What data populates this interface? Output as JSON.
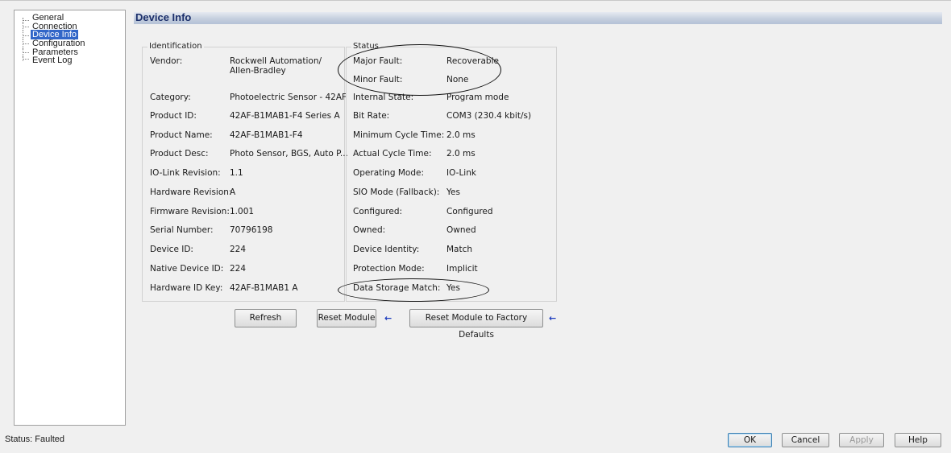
{
  "tree": {
    "items": [
      {
        "label": "General"
      },
      {
        "label": "Connection"
      },
      {
        "label": "Device Info"
      },
      {
        "label": "Configuration"
      },
      {
        "label": "Parameters"
      },
      {
        "label": "Event Log"
      }
    ],
    "selected": "Device Info"
  },
  "header": {
    "title": "Device Info"
  },
  "identification": {
    "title": "Identification",
    "rows": [
      {
        "label": "Vendor:",
        "value": "Rockwell Automation/",
        "value2": "Allen-Bradley"
      },
      {
        "label": "Category:",
        "value": "Photoelectric Sensor - 42AF"
      },
      {
        "label": "Product ID:",
        "value": "42AF-B1MAB1-F4 Series A"
      },
      {
        "label": "Product Name:",
        "value": "42AF-B1MAB1-F4"
      },
      {
        "label": "Product Desc:",
        "value": "Photo Sensor, BGS, Auto P..."
      },
      {
        "label": "IO-Link Revision:",
        "value": "1.1"
      },
      {
        "label": "Hardware Revision:",
        "value": "A"
      },
      {
        "label": "Firmware Revision:",
        "value": "1.001"
      },
      {
        "label": "Serial Number:",
        "value": "70796198"
      },
      {
        "label": "Device ID:",
        "value": "224"
      },
      {
        "label": "Native Device ID:",
        "value": "224"
      },
      {
        "label": "Hardware ID Key:",
        "value": "42AF-B1MAB1 A"
      }
    ]
  },
  "status": {
    "title": "Status",
    "rows": [
      {
        "label": "Major Fault:",
        "value": "Recoverable"
      },
      {
        "label": "Minor Fault:",
        "value": "None"
      },
      {
        "label": "Internal State:",
        "value": "Program mode"
      },
      {
        "label": "Bit Rate:",
        "value": "COM3 (230.4 kbit/s)"
      },
      {
        "label": "Minimum Cycle Time:",
        "value": "2.0 ms"
      },
      {
        "label": "Actual Cycle Time:",
        "value": "2.0 ms"
      },
      {
        "label": "Operating Mode:",
        "value": "IO-Link"
      },
      {
        "label": "SIO Mode (Fallback):",
        "value": "Yes"
      },
      {
        "label": "Configured:",
        "value": "Configured"
      },
      {
        "label": "Owned:",
        "value": "Owned"
      },
      {
        "label": "Device Identity:",
        "value": "Match"
      },
      {
        "label": "Protection Mode:",
        "value": "Implicit"
      },
      {
        "label": "Data Storage Match:",
        "value": "Yes"
      }
    ]
  },
  "actions": {
    "refresh": "Refresh",
    "reset_module": "Reset Module",
    "reset_factory": "Reset Module to Factory Defaults",
    "arrow_icon": "left-arrow-icon",
    "arrow_color": "#1c3bbd"
  },
  "footer": {
    "status": "Status: Faulted",
    "ok": "OK",
    "cancel": "Cancel",
    "apply": "Apply",
    "help": "Help"
  },
  "colors": {
    "header_text": "#1b2f6b",
    "selection": "#3166c8",
    "annotation": "#111111"
  }
}
